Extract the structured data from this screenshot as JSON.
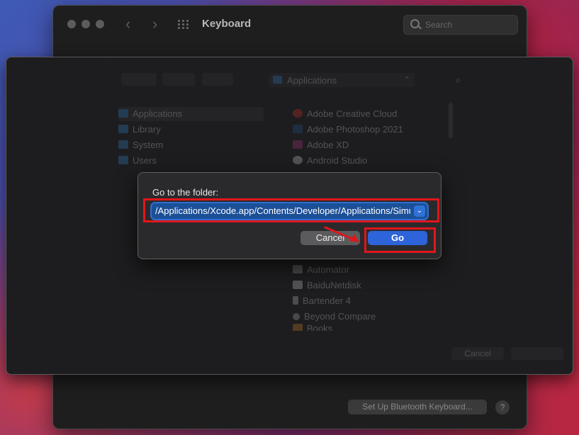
{
  "keyboard_window": {
    "title": "Keyboard",
    "search_placeholder": "Search",
    "bluetooth_button": "Set Up Bluetooth Keyboard...",
    "help_button": "?"
  },
  "finder_sheet": {
    "location": "Applications",
    "sidebar_items": [
      "Applications",
      "Library",
      "System",
      "Users"
    ],
    "app_items_top": [
      "Adobe Creative Cloud",
      "Adobe Photoshop 2021",
      "Adobe XD",
      "Android Studio"
    ],
    "app_items_bottom": [
      "Automator",
      "BaiduNetdisk",
      "Bartender 4",
      "Beyond Compare",
      "Books"
    ],
    "cancel_label": "Cancel"
  },
  "goto_dialog": {
    "label": "Go to the folder:",
    "path_value": "/Applications/Xcode.app/Contents/Developer/Applications/Simulator.app",
    "cancel_label": "Cancel",
    "go_label": "Go"
  },
  "colors": {
    "accent": "#2d64d9",
    "annotation": "#e0161b"
  }
}
